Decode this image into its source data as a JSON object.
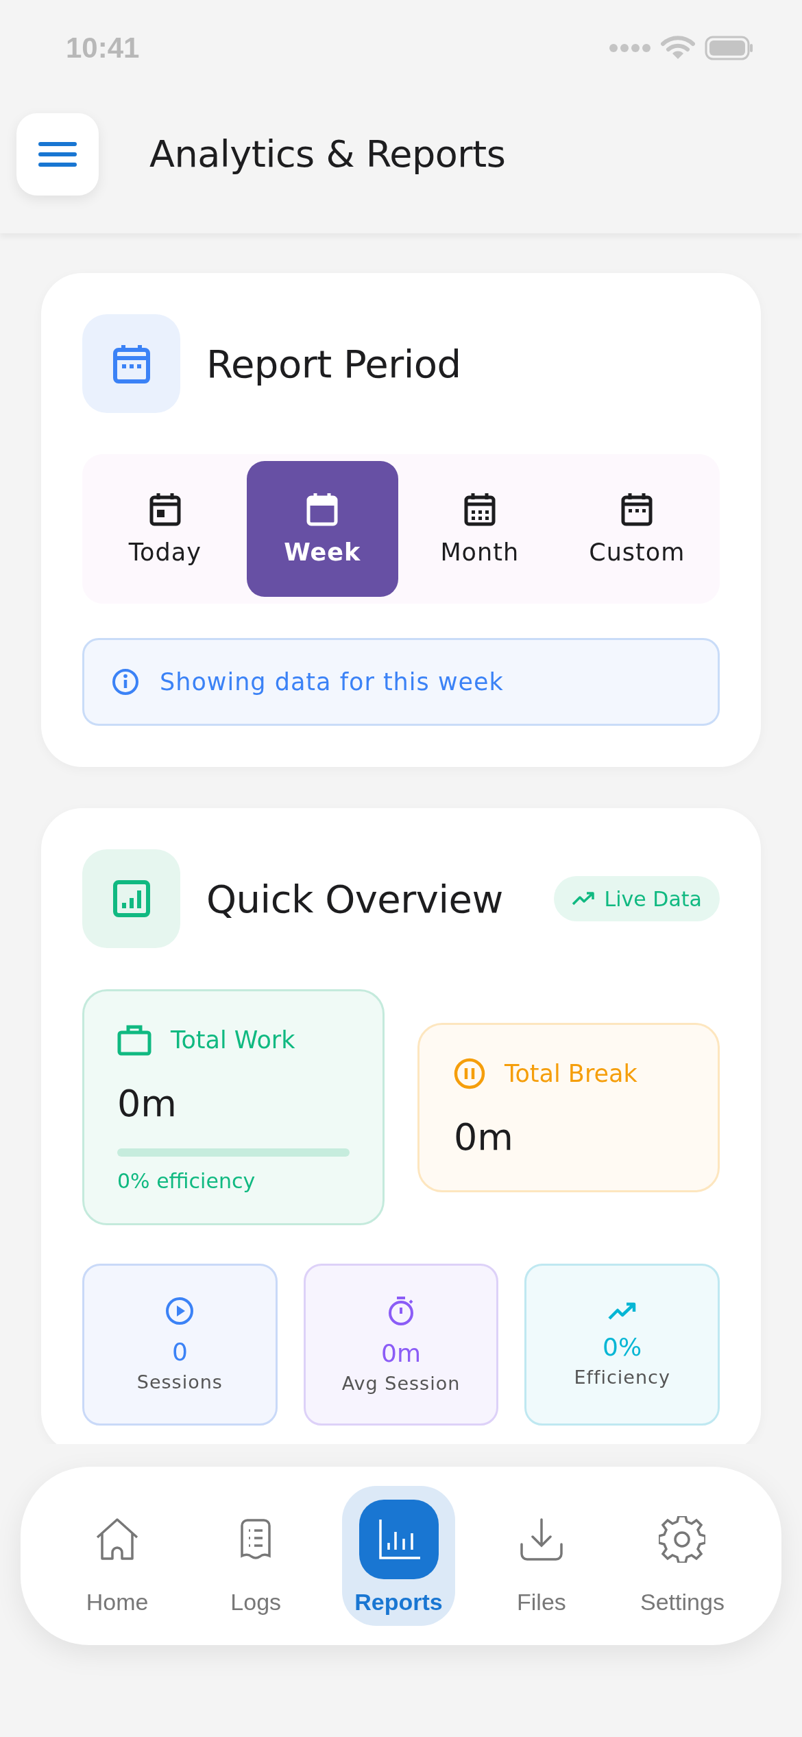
{
  "status_bar": {
    "time": "10:41"
  },
  "header": {
    "title": "Analytics & Reports"
  },
  "period": {
    "title": "Report Period",
    "options": [
      {
        "label": "Today",
        "kind": "today",
        "selected": false
      },
      {
        "label": "Week",
        "kind": "week",
        "selected": true
      },
      {
        "label": "Month",
        "kind": "month",
        "selected": false
      },
      {
        "label": "Custom",
        "kind": "custom",
        "selected": false
      }
    ],
    "info": "Showing data for this week"
  },
  "overview": {
    "title": "Quick Overview",
    "badge": "Live Data",
    "work": {
      "label": "Total Work",
      "value": "0m",
      "level": 0,
      "caption": "0% efficiency"
    },
    "break": {
      "label": "Total Break",
      "value": "0m"
    },
    "stats": [
      {
        "kind": "sessions",
        "value": "0",
        "label": "Sessions",
        "color": "#3b82f6"
      },
      {
        "kind": "avg",
        "value": "0m",
        "label": "Avg Session",
        "color": "#8b5cf6"
      },
      {
        "kind": "efficiency",
        "value": "0%",
        "label": "Efficiency",
        "color": "#06b6d4"
      }
    ]
  },
  "nav": [
    {
      "label": "Home",
      "kind": "home",
      "selected": false
    },
    {
      "label": "Logs",
      "kind": "logs",
      "selected": false
    },
    {
      "label": "Reports",
      "kind": "reports",
      "selected": true
    },
    {
      "label": "Files",
      "kind": "files",
      "selected": false
    },
    {
      "label": "Settings",
      "kind": "settings",
      "selected": false
    }
  ]
}
